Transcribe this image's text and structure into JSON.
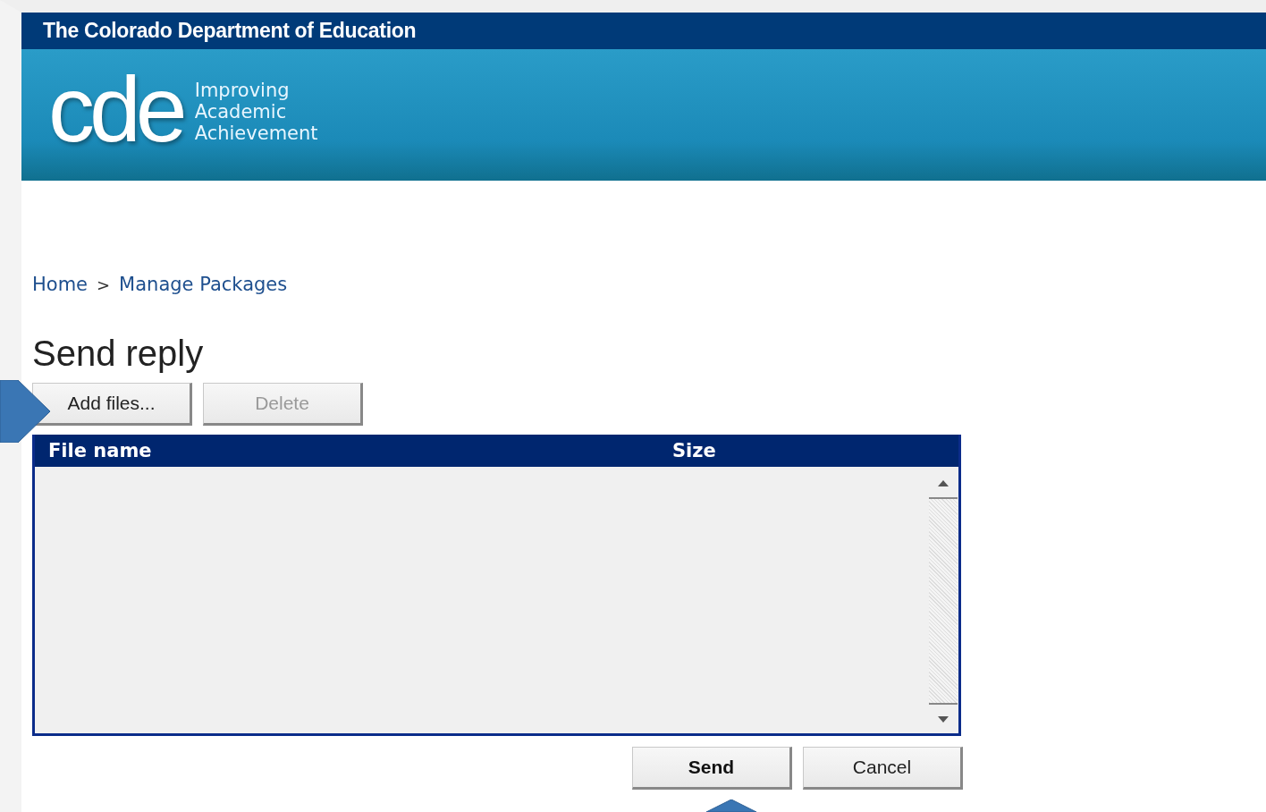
{
  "header": {
    "title": "The Colorado Department of Education"
  },
  "logo": {
    "mark": "cde",
    "tagline": [
      "Improving",
      "Academic",
      "Achievement"
    ]
  },
  "breadcrumb": {
    "items": [
      "Home",
      "Manage Packages"
    ],
    "separator": ">"
  },
  "page_title": "Send reply",
  "toolbar": [
    {
      "label": "Add files...",
      "disabled": false
    },
    {
      "label": "Delete",
      "disabled": true
    }
  ],
  "table": {
    "columns": [
      "File name",
      "Size"
    ]
  },
  "actions": [
    {
      "label": "Send",
      "kind": "primary"
    },
    {
      "label": "Cancel",
      "kind": "default"
    }
  ]
}
